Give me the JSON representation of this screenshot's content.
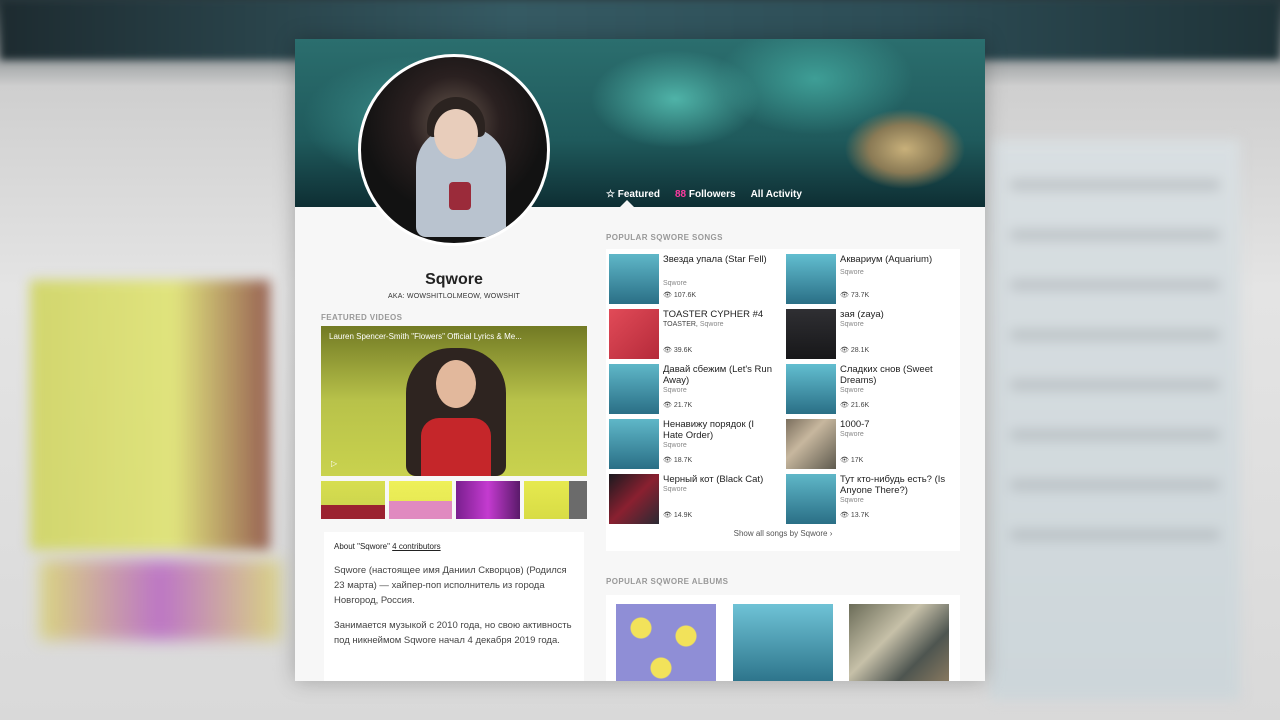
{
  "banner": {
    "tabs": [
      {
        "icon": "star-icon",
        "label": "Featured"
      },
      {
        "count": "88",
        "label": "Followers"
      },
      {
        "label": "All Activity"
      }
    ]
  },
  "artist": {
    "name": "Sqwore",
    "aka": "AKA: WOWSHITLOLMEOW, WOWSHIT"
  },
  "featured_videos": {
    "label": "FEATURED VIDEOS",
    "main_title": "Lauren Spencer-Smith \"Flowers\" Official Lyrics & Me..."
  },
  "about": {
    "heading": "About \"Sqwore\"",
    "contributors": "4 contributors",
    "paragraphs": [
      "Sqwore (настоящее имя Даниил Скворцов) (Родился 23 марта) — хайпер-поп исполнитель из города Новгород, Россия.",
      "Занимается музыкой с 2010 года, но свою активность под никнеймом Sqwore начал 4 декабря 2019 года."
    ]
  },
  "songs": {
    "label": "POPULAR SQWORE SONGS",
    "items": [
      {
        "title": "Звезда упала (Star Fell)",
        "artist": "Sqwore",
        "views": "107.6K"
      },
      {
        "title": "Аквариум (Aquarium)",
        "artist": "Sqwore",
        "views": "73.7K"
      },
      {
        "title": "TOASTER CYPHER #4",
        "artist": "TOASTER,",
        "artist2": "Sqwore",
        "views": "39.6K"
      },
      {
        "title": "зая (zaya)",
        "artist": "Sqwore",
        "views": "28.1K"
      },
      {
        "title": "Давай сбежим (Let's Run Away)",
        "artist": "Sqwore",
        "views": "21.7K"
      },
      {
        "title": "Сладких снов (Sweet Dreams)",
        "artist": "Sqwore",
        "views": "21.6K"
      },
      {
        "title": "Ненавижу порядок (I Hate Order)",
        "artist": "Sqwore",
        "views": "18.7K"
      },
      {
        "title": "1000-7",
        "artist": "Sqwore",
        "views": "17K"
      },
      {
        "title": "Черный кот (Black Cat)",
        "artist": "Sqwore",
        "views": "14.9K"
      },
      {
        "title": "Тут кто-нибудь есть? (Is Anyone There?)",
        "artist": "Sqwore",
        "views": "13.7K"
      }
    ],
    "show_all": "Show all songs by Sqwore"
  },
  "albums": {
    "label": "POPULAR SQWORE ALBUMS"
  },
  "colors": {
    "accent_pink": "#ff3aa0"
  }
}
